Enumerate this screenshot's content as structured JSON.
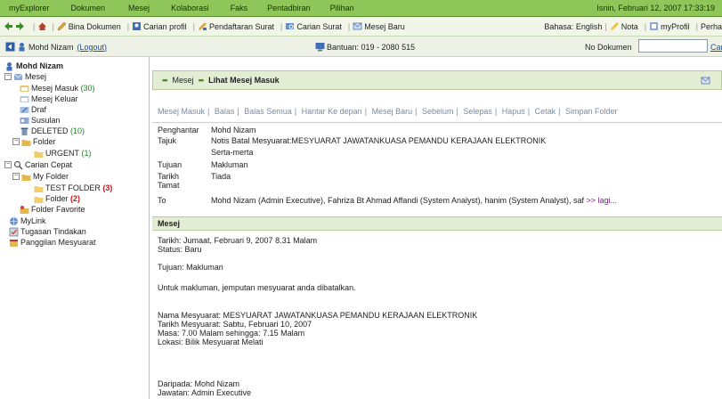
{
  "menu": {
    "items": [
      "myExplorer",
      "Dokumen",
      "Mesej",
      "Kolaborasi",
      "Faks",
      "Pentadbiran",
      "Pilihan"
    ],
    "datetime": "Isnin, Februari 12, 2007 17:33:19"
  },
  "toolbar": {
    "bina": "Bina Dokumen",
    "carian_profil": "Carian profil",
    "pendaftaran": "Pendaftaran Surat",
    "carian_surat": "Carian Surat",
    "mesej_baru": "Mesej Baru",
    "bahasa": "Bahasa: English",
    "nota": "Nota",
    "myprofil": "myProfil",
    "perhatian": "Perha"
  },
  "userbar": {
    "name": "Mohd Nizam",
    "logout": "(Logout)",
    "bantuan": "Bantuan: 019 - 2080 515",
    "no_dokumen": "No Dokumen",
    "cari": "Car",
    "no_dokumen_value": ""
  },
  "sidebar": {
    "user": "Mohd Nizam",
    "mesej": "Mesej",
    "masuk": "Mesej Masuk",
    "masuk_count": "(30)",
    "keluar": "Mesej Keluar",
    "draf": "Draf",
    "susulan": "Susulan",
    "deleted": "DELETED",
    "deleted_count": "(10)",
    "folder": "Folder",
    "urgent": "URGENT",
    "urgent_count": "(1)",
    "carian_cepat": "Carian Cepat",
    "my_folder": "My Folder",
    "test_folder": "TEST FOLDER",
    "test_count": "(3)",
    "folder2": "Folder",
    "folder2_count": "(2)",
    "fav": "Folder Favorite",
    "mylink": "MyLink",
    "tugasan": "Tugasan Tindakan",
    "panggilan": "Panggilan Mesyuarat"
  },
  "content": {
    "breadcrumb1": "Mesej",
    "breadcrumb2": "Lihat Mesej Masuk",
    "actions": [
      "Mesej Masuk",
      "Balas",
      "Balas Semua",
      "Hantar Ke depan",
      "Mesej Baru",
      "Sebelum",
      "Selepas",
      "Hapus",
      "Cetak",
      "Simpan Folder"
    ],
    "meta": {
      "penghantar_lbl": "Penghantar",
      "penghantar": "Mohd Nizam",
      "tajuk_lbl": "Tajuk",
      "tajuk": "Notis Batal Mesyuarat:MESYUARAT JAWATANKUASA PEMANDU KERAJAAN ELEKTRONIK",
      "priority": "Serta-merta",
      "tujuan_lbl": "Tujuan",
      "tujuan": "Makluman",
      "tarikh_lbl": "Tarikh",
      "tarikh": "Tiada",
      "tamat_lbl": "Tamat",
      "to_lbl": "To",
      "to": "Mohd Nizam (Admin Executive), Fahriza Bt Ahmad Affandi (System Analyst), hanim (System Analyst), saf",
      "lagi": ">> lagi..."
    },
    "section": "Mesej",
    "body": {
      "l1": "Tarikh: Jumaat, Februari 9, 2007 8.31 Malam",
      "l2": "Status: Baru",
      "l3": "Tujuan: Makluman",
      "l4": "Untuk makluman, jemputan mesyuarat anda dibatalkan.",
      "l5": "Nama Mesyuarat: MESYUARAT JAWATANKUASA PEMANDU KERAJAAN ELEKTRONIK",
      "l6": "Tarikh Mesyuarat: Sabtu, Februari 10, 2007",
      "l7": "Masa: 7.00 Malam sehingga: 7.15 Malam",
      "l8": "Lokasi: Bilik Mesyuarat Melati",
      "l9": "Daripada: Mohd Nizam",
      "l10": "Jawatan: Admin Executive"
    }
  }
}
